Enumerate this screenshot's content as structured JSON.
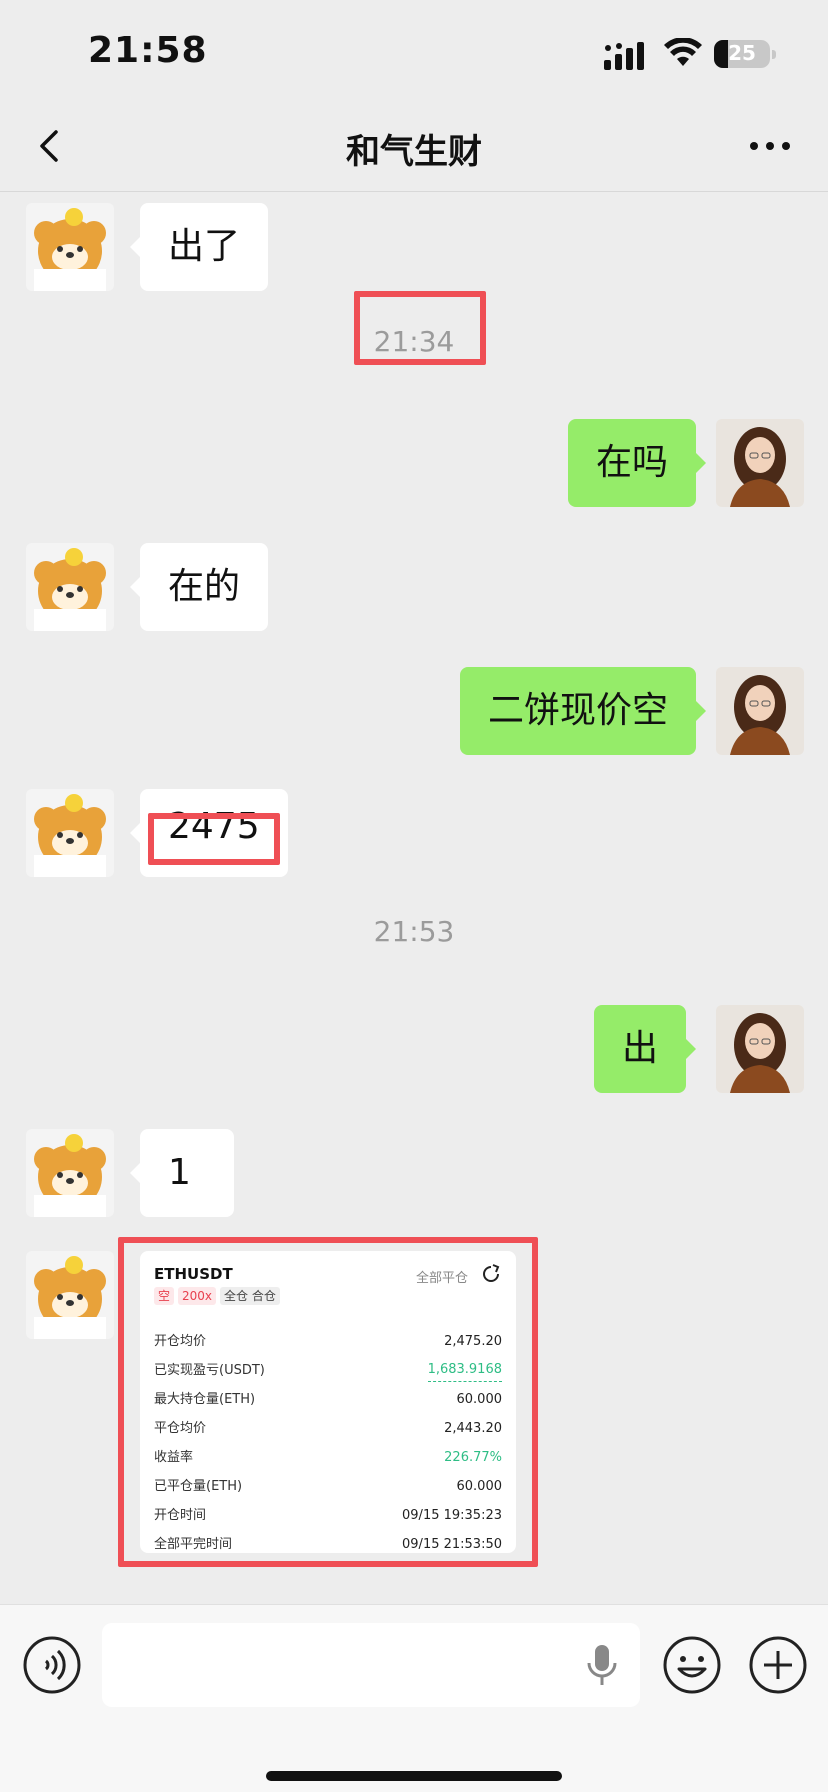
{
  "status_bar": {
    "time": "21:58",
    "battery": "25",
    "battery_level_pct": 25
  },
  "nav": {
    "title": "和气生财"
  },
  "messages": [
    {
      "side": "left",
      "text": "出了",
      "avatar": "bear-avatar"
    },
    {
      "type": "timestamp",
      "text": "21:34",
      "highlighted": true
    },
    {
      "side": "right",
      "text": "在吗",
      "avatar": "woman-avatar"
    },
    {
      "side": "left",
      "text": "在的",
      "avatar": "bear-avatar"
    },
    {
      "side": "right",
      "text": "二饼现价空",
      "avatar": "woman-avatar"
    },
    {
      "side": "left",
      "text": "2475",
      "avatar": "bear-avatar",
      "highlighted": true
    },
    {
      "type": "timestamp",
      "text": "21:53"
    },
    {
      "side": "right",
      "text": "出",
      "avatar": "woman-avatar"
    },
    {
      "side": "left",
      "text": "1",
      "avatar": "bear-avatar"
    },
    {
      "side": "left",
      "type": "trade-card",
      "avatar": "bear-avatar",
      "highlighted": true
    }
  ],
  "trade_card": {
    "symbol": "ETHUSDT",
    "action": "全部平仓",
    "tags": [
      "空",
      "200x",
      "全仓 合仓"
    ],
    "rows": [
      {
        "label": "开仓均价",
        "value": "2,475.20"
      },
      {
        "label": "已实现盈亏(USDT)",
        "value": "1,683.9168"
      },
      {
        "label": "最大持仓量(ETH)",
        "value": "60.000"
      },
      {
        "label": "平仓均价",
        "value": "2,443.20"
      },
      {
        "label": "收益率",
        "value": "226.77%"
      },
      {
        "label": "已平仓量(ETH)",
        "value": "60.000"
      },
      {
        "label": "开仓时间",
        "value": "09/15 19:35:23"
      },
      {
        "label": "全部平完时间",
        "value": "09/15 21:53:50"
      }
    ]
  },
  "colors": {
    "background": "#ededed",
    "bubble_right": "#95ec69",
    "bubble_left": "#ffffff",
    "highlight": "#ef4f55",
    "profit_green": "#2ebd85",
    "short_red": "#e8414f"
  },
  "input_bar": {
    "placeholder": ""
  }
}
